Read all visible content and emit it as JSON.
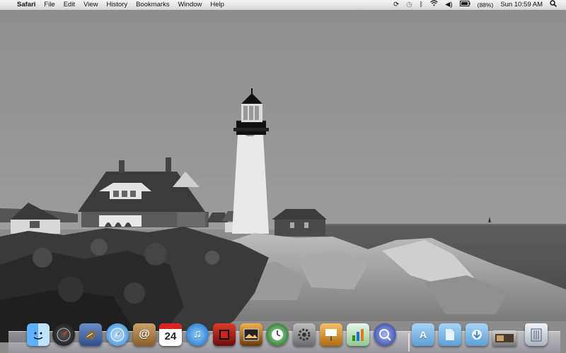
{
  "menubar": {
    "app_name": "Safari",
    "menus": [
      "File",
      "Edit",
      "View",
      "History",
      "Bookmarks",
      "Window",
      "Help"
    ],
    "battery": "(88%)",
    "clock": "Sun 10:59 AM"
  },
  "dock": {
    "calendar_day": "24",
    "apps": [
      "finder",
      "dashboard",
      "mail",
      "safari",
      "address-book",
      "ical",
      "itunes",
      "front-row",
      "iphoto",
      "time-machine",
      "system-preferences",
      "keynote",
      "numbers",
      "preview"
    ],
    "folders": [
      "applications",
      "documents",
      "downloads"
    ]
  }
}
